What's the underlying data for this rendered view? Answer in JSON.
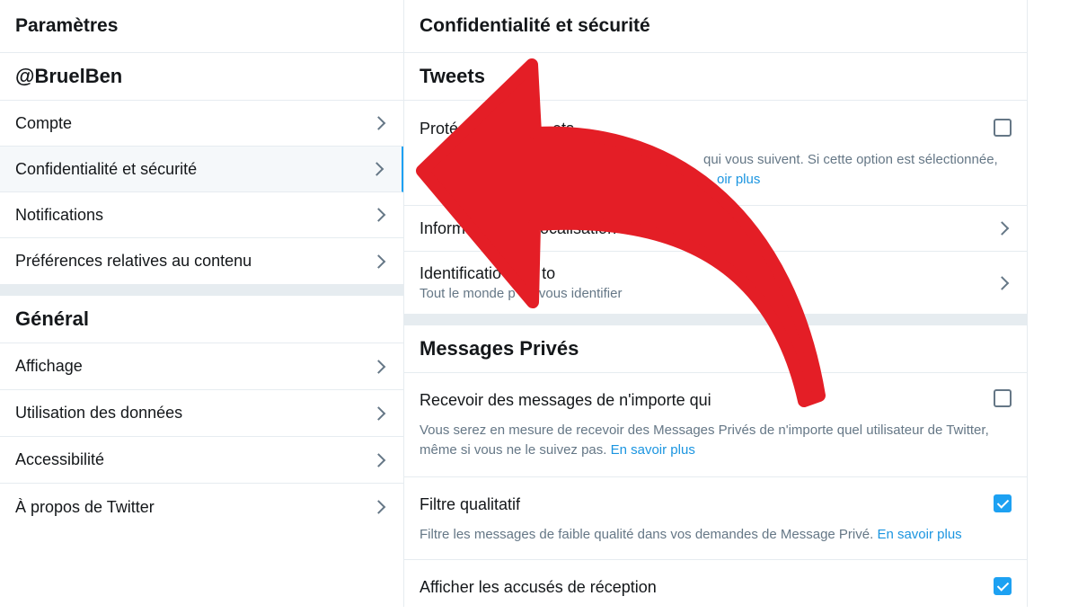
{
  "left": {
    "header": "Paramètres",
    "account_handle": "@BruelBen",
    "account_items": [
      {
        "label": "Compte"
      },
      {
        "label": "Confidentialité et sécurité"
      },
      {
        "label": "Notifications"
      },
      {
        "label": "Préférences relatives au contenu"
      }
    ],
    "general_title": "Général",
    "general_items": [
      {
        "label": "Affichage"
      },
      {
        "label": "Utilisation des données"
      },
      {
        "label": "Accessibilité"
      },
      {
        "label": "À propos de Twitter"
      }
    ]
  },
  "right": {
    "header": "Confidentialité et sécurité",
    "tweets_section": "Tweets",
    "protect": {
      "title": "Proté",
      "title_tail": "ets",
      "desc_tail": "qui vous suivent. Si cette option est sélectionnée,",
      "link_partial": "oir plus"
    },
    "location": {
      "title_start": "Inform",
      "title_end": "ocalisation"
    },
    "photo_tag": {
      "title_start": "Identificatio",
      "title_end": "to",
      "desc_start": "Tout le monde p",
      "desc_end": "vous identifier"
    },
    "dm_section": "Messages Privés",
    "dm_anyone": {
      "title": "Recevoir des messages de n'importe qui",
      "desc": "Vous serez en mesure de recevoir des Messages Privés de n'importe quel utilisateur de Twitter, même si vous ne le suivez pas.",
      "link": "En savoir plus",
      "checked": false
    },
    "quality_filter": {
      "title": "Filtre qualitatif",
      "desc": "Filtre les messages de faible qualité dans vos demandes de Message Privé.",
      "link": "En savoir plus",
      "checked": true
    },
    "read_receipts": {
      "title": "Afficher les accusés de réception",
      "checked": true
    }
  },
  "colors": {
    "accent": "#1da1f2",
    "link": "#1b95e0",
    "arrow": "#e41e26",
    "divider": "#e6ecf0"
  },
  "overlay": {
    "icon": "red-curved-arrow-icon"
  }
}
